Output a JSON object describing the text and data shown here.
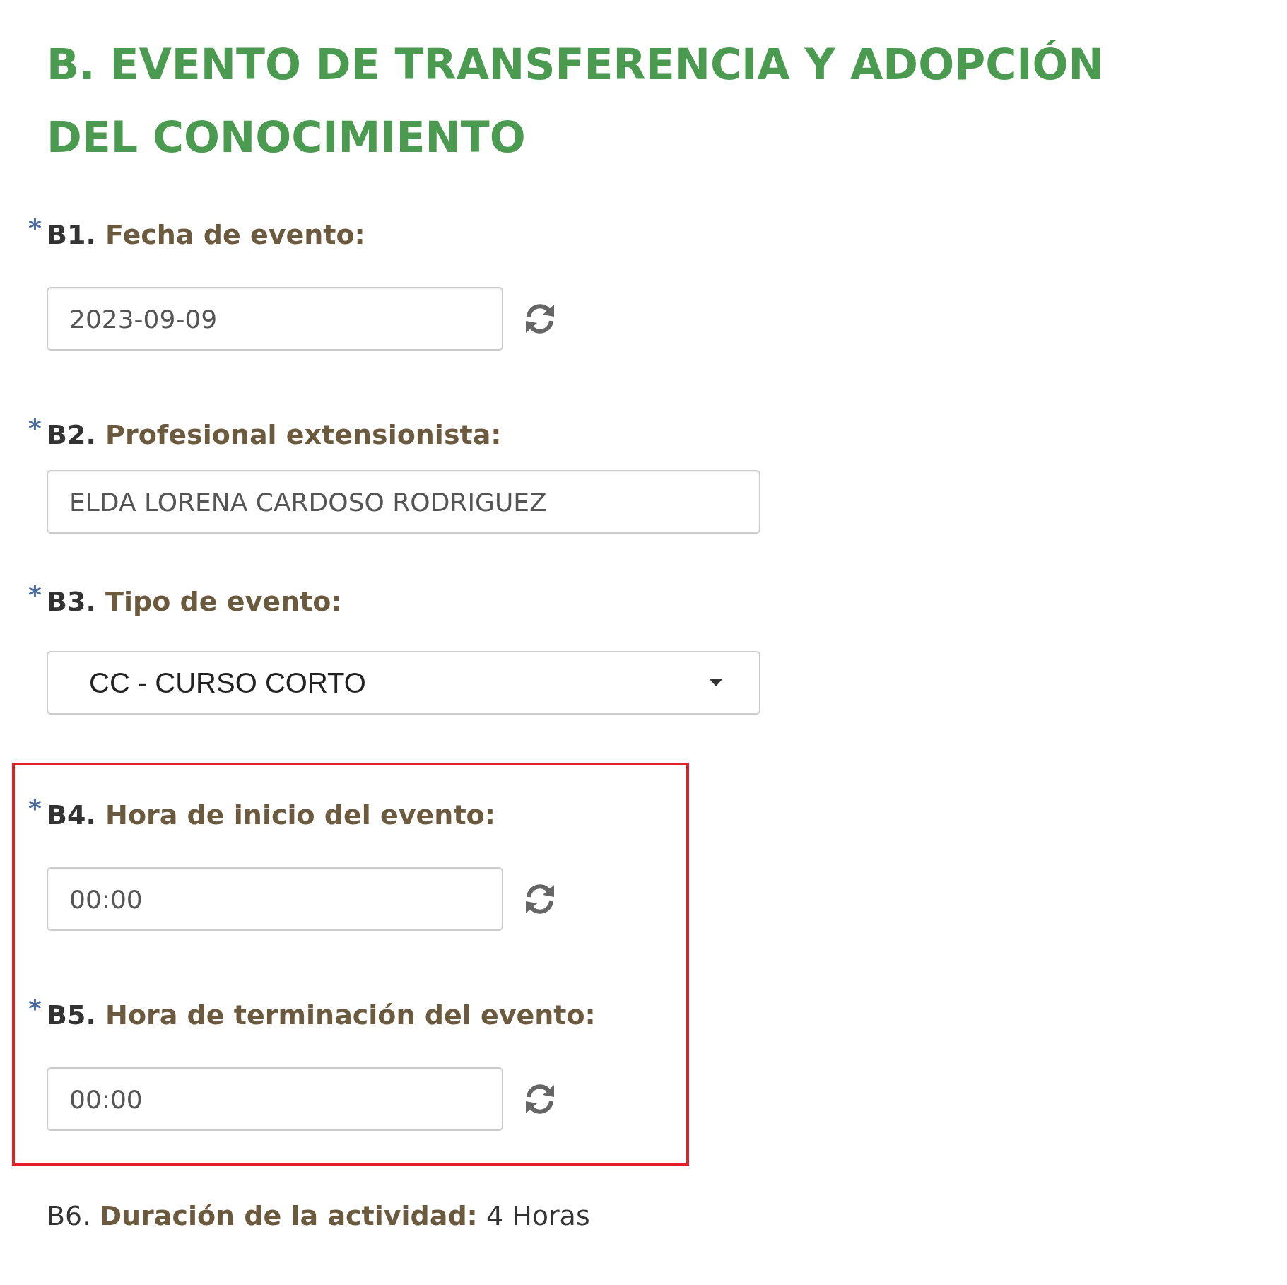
{
  "title": "B. EVENTO DE TRANSFERENCIA Y ADOPCIÓN DEL CONOCIMIENTO",
  "questions": [
    {
      "kind": "input",
      "required_mark": "*",
      "code": "B1.",
      "label": "Fecha de evento:",
      "value": "2023-09-09",
      "refresh": true,
      "highlighted": false
    },
    {
      "kind": "input_wide",
      "required_mark": "*",
      "code": "B2.",
      "label": "Profesional extensionista:",
      "value": "ELDA LORENA CARDOSO RODRIGUEZ",
      "refresh": false,
      "highlighted": false
    },
    {
      "kind": "select",
      "required_mark": "*",
      "code": "B3.",
      "label": "Tipo de evento:",
      "value": "CC - CURSO CORTO",
      "refresh": false,
      "highlighted": false
    },
    {
      "kind": "input",
      "required_mark": "*",
      "code": "B4.",
      "label": "Hora de inicio del evento:",
      "value": "00:00",
      "refresh": true,
      "highlighted": true
    },
    {
      "kind": "input",
      "required_mark": "*",
      "code": "B5.",
      "label": "Hora de terminación del evento:",
      "value": "00:00",
      "refresh": true,
      "highlighted": true
    }
  ],
  "summary": {
    "code": "B6.",
    "label": "Duración de la actividad:",
    "value": "4 Horas"
  }
}
